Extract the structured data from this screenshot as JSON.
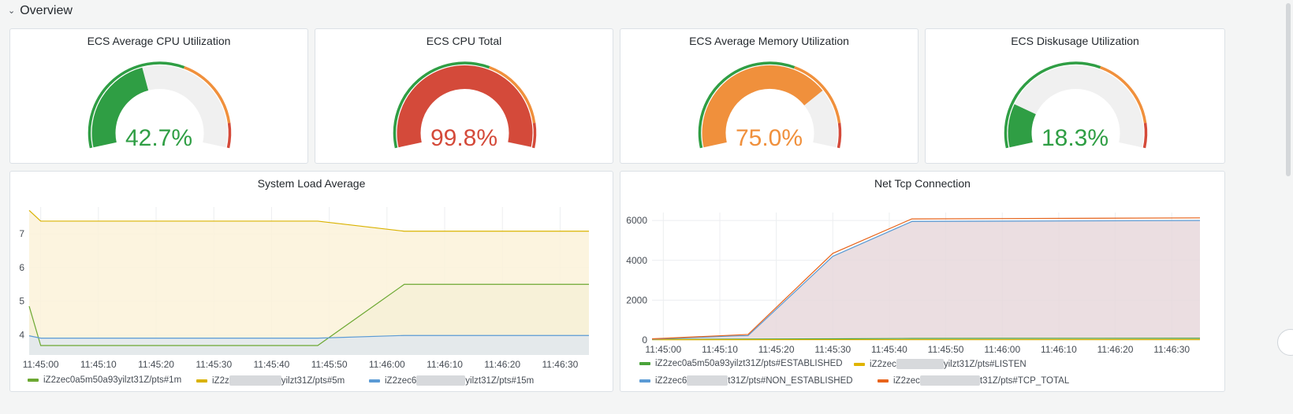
{
  "row": {
    "title": "Overview",
    "chevron_icon": "chevron-down-icon"
  },
  "gauges": [
    {
      "title": "ECS Average CPU Utilization",
      "value": 42.7,
      "display": "42.7%",
      "color": "#2f9e44"
    },
    {
      "title": "ECS CPU Total",
      "value": 99.8,
      "display": "99.8%",
      "color": "#d44a3a"
    },
    {
      "title": "ECS Average Memory Utilization",
      "value": 75.0,
      "display": "75.0%",
      "color": "#f0903c"
    },
    {
      "title": "ECS Diskusage Utilization",
      "value": 18.3,
      "display": "18.3%",
      "color": "#2f9e44"
    }
  ],
  "threshold_colors": {
    "ok": "#2f9e44",
    "warn": "#f0903c",
    "critical": "#d44a3a",
    "track": "#f0f0f0"
  },
  "load_panel": {
    "title": "System Load Average",
    "legend": [
      {
        "pre": "iZ2zec0a5m50a93yilzt31Z/pts#1m",
        "color": "#6ca832"
      },
      {
        "pre": "iZ2z",
        "post": "yilzt31Z/pts#5m",
        "color": "#d9b200"
      },
      {
        "pre": "iZ2zec6",
        "post": "yilzt31Z/pts#15m",
        "color": "#5b9bd5"
      }
    ]
  },
  "tcp_panel": {
    "title": "Net Tcp Connection",
    "legend": [
      {
        "pre": "iZ2zec0a5m50a93yilzt31Z/pts#ESTABLISHED",
        "color": "#4aa33a"
      },
      {
        "pre": "iZ2zec",
        "post": "yilzt31Z/pts#LISTEN",
        "color": "#e0b400"
      },
      {
        "pre": "iZ2zec6",
        "post": "t31Z/pts#NON_ESTABLISHED",
        "color": "#5b9bd5"
      },
      {
        "pre": "iZ2zec",
        "post": "t31Z/pts#TCP_TOTAL",
        "color": "#e8641b"
      }
    ]
  },
  "chart_data": [
    {
      "type": "area",
      "title": "System Load Average",
      "x": [
        "11:45:00",
        "11:45:10",
        "11:45:20",
        "11:45:30",
        "11:45:40",
        "11:45:50",
        "11:46:00",
        "11:46:10",
        "11:46:20",
        "11:46:30"
      ],
      "x_numeric": [
        0,
        10,
        20,
        30,
        40,
        50,
        60,
        70,
        80,
        90
      ],
      "ylim": [
        3.4,
        7.8
      ],
      "yticks": [
        "4",
        "5",
        "6",
        "7"
      ],
      "ytick_values": [
        4,
        5,
        6,
        7
      ],
      "series": [
        {
          "name": "iZ2zec0a5m50a93yilzt31Z/pts#1m",
          "color": "#6ca832",
          "fill": "#d8e4c4",
          "points": [
            [
              -2,
              4.85
            ],
            [
              0,
              3.68
            ],
            [
              48,
              3.68
            ],
            [
              63,
              5.5
            ],
            [
              95,
              5.5
            ]
          ]
        },
        {
          "name": "5m",
          "color": "#d9b200",
          "fill": "#fbf2d9",
          "points": [
            [
              -2,
              7.7
            ],
            [
              0,
              7.38
            ],
            [
              48,
              7.38
            ],
            [
              63,
              7.08
            ],
            [
              95,
              7.08
            ]
          ]
        },
        {
          "name": "15m",
          "color": "#5b9bd5",
          "fill": "#e0e7ee",
          "points": [
            [
              -2,
              3.97
            ],
            [
              0,
              3.9
            ],
            [
              48,
              3.9
            ],
            [
              63,
              3.98
            ],
            [
              95,
              3.98
            ]
          ]
        }
      ]
    },
    {
      "type": "area",
      "title": "Net Tcp Connection",
      "x": [
        "11:45:00",
        "11:45:10",
        "11:45:20",
        "11:45:30",
        "11:45:40",
        "11:45:50",
        "11:46:00",
        "11:46:10",
        "11:46:20",
        "11:46:30"
      ],
      "x_numeric": [
        0,
        10,
        20,
        30,
        40,
        50,
        60,
        70,
        80,
        90
      ],
      "ylim": [
        0,
        6400
      ],
      "yticks": [
        "0",
        "2000",
        "4000",
        "6000"
      ],
      "ytick_values": [
        0,
        2000,
        4000,
        6000
      ],
      "series": [
        {
          "name": "iZ2zec0a5m50a93yilzt31Z/pts#ESTABLISHED",
          "color": "#4aa33a",
          "fill": "none",
          "points": [
            [
              -2,
              30
            ],
            [
              10,
              40
            ],
            [
              20,
              50
            ],
            [
              30,
              60
            ],
            [
              44,
              80
            ],
            [
              95,
              90
            ]
          ]
        },
        {
          "name": "LISTEN",
          "color": "#e0b400",
          "fill": "none",
          "points": [
            [
              -2,
              15
            ],
            [
              95,
              20
            ]
          ]
        },
        {
          "name": "NON_ESTABLISHED",
          "color": "#5b9bd5",
          "fill": "#e8d8dc",
          "points": [
            [
              -2,
              40
            ],
            [
              12,
              200
            ],
            [
              15,
              220
            ],
            [
              30,
              4200
            ],
            [
              44,
              5950
            ],
            [
              95,
              6000
            ]
          ]
        },
        {
          "name": "TCP_TOTAL",
          "color": "#e8641b",
          "fill": "none",
          "points": [
            [
              -2,
              60
            ],
            [
              12,
              240
            ],
            [
              15,
              280
            ],
            [
              30,
              4350
            ],
            [
              44,
              6080
            ],
            [
              95,
              6130
            ]
          ]
        }
      ]
    }
  ]
}
